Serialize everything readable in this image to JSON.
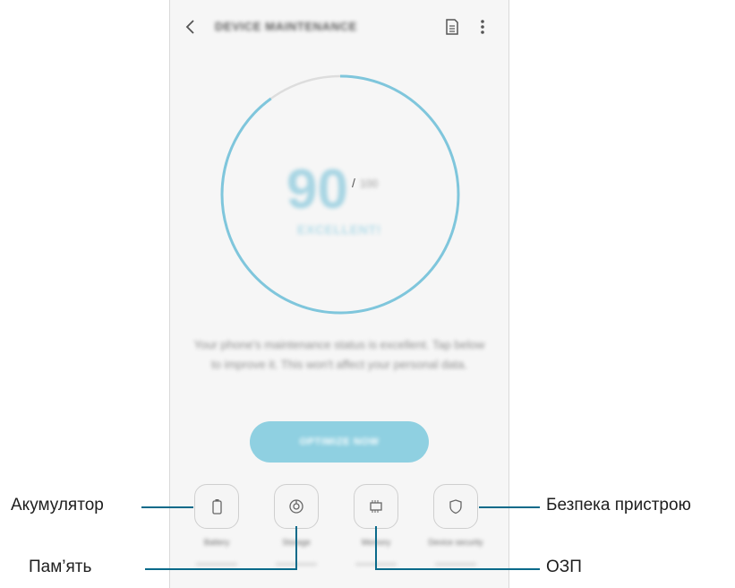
{
  "screen": {
    "title": "DEVICE MAINTENANCE",
    "score": "90",
    "score_separator": "/",
    "score_max": "100",
    "score_fraction": 0.9,
    "status": "EXCELLENT!",
    "description": "Your phone's maintenance status is excellent. Tap below to improve it. This won't affect your personal data.",
    "optimize_button": "OPTIMIZE NOW",
    "tiles": [
      {
        "label": "Battery",
        "icon": "battery-icon"
      },
      {
        "label": "Storage",
        "icon": "storage-icon"
      },
      {
        "label": "Memory",
        "icon": "memory-chip-icon"
      },
      {
        "label": "Device security",
        "icon": "shield-icon"
      }
    ]
  },
  "annotations": {
    "battery": "Акумулятор",
    "storage": "Пам’ять",
    "memory": "ОЗП",
    "security": "Безпека пристрою"
  },
  "colors": {
    "accent": "#7fc6dc",
    "ring_track": "#dddddd",
    "callout_line": "#0a6a8a"
  }
}
